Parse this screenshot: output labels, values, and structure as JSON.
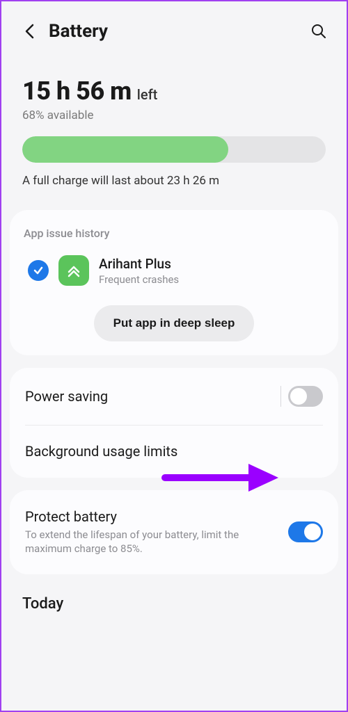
{
  "header": {
    "title": "Battery"
  },
  "hero": {
    "time_value": "15 h 56 m",
    "time_suffix": "left",
    "percent_text": "68% available",
    "progress_percent": 68,
    "full_charge_text": "A full charge will last about 23 h 26 m"
  },
  "app_issue": {
    "section_title": "App issue history",
    "app_name": "Arihant Plus",
    "app_subtitle": "Frequent crashes",
    "button_label": "Put app in deep sleep"
  },
  "settings": {
    "power_saving_label": "Power saving",
    "power_saving_on": false,
    "bg_limits_label": "Background usage limits"
  },
  "protect": {
    "label": "Protect battery",
    "description": "To extend the lifespan of your battery, limit the maximum charge to 85%.",
    "on": true
  },
  "footer": {
    "today_label": "Today"
  },
  "colors": {
    "accent_blue": "#1e78e8",
    "progress_green": "#82d482",
    "annotation_purple": "#9a00ff"
  }
}
